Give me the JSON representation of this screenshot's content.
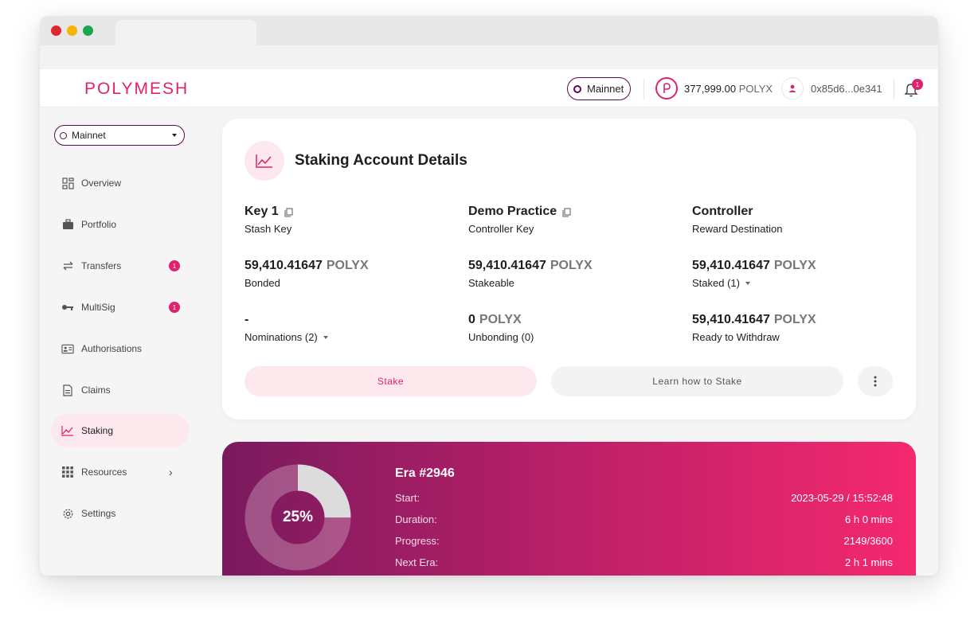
{
  "header": {
    "logo": "POLYMESH",
    "network": "Mainnet",
    "balance_value": "377,999.00",
    "balance_unit": "POLYX",
    "account": "0x85d6...0e341",
    "notification_count": "1"
  },
  "sidebar": {
    "network_select": "Mainnet",
    "items": [
      {
        "label": "Overview",
        "icon": "overview-icon"
      },
      {
        "label": "Portfolio",
        "icon": "briefcase-icon"
      },
      {
        "label": "Transfers",
        "icon": "transfer-icon",
        "badge": "1"
      },
      {
        "label": "MultiSig",
        "icon": "key-icon",
        "badge": "1"
      },
      {
        "label": "Authorisations",
        "icon": "id-card-icon"
      },
      {
        "label": "Claims",
        "icon": "document-icon"
      },
      {
        "label": "Staking",
        "icon": "chart-line-icon",
        "active": true
      },
      {
        "label": "Resources",
        "icon": "grid-icon"
      },
      {
        "label": "Settings",
        "icon": "gear-icon"
      }
    ]
  },
  "staking": {
    "title": "Staking Account Details",
    "key1_name": "Key 1",
    "key1_sub": "Stash Key",
    "key2_name": "Demo Practice",
    "key2_sub": "Controller Key",
    "key3_name": "Controller",
    "key3_sub": "Reward Destination",
    "bonded_value": "59,410.41647",
    "bonded_label": "Bonded",
    "stakeable_value": "59,410.41647",
    "stakeable_label": "Stakeable",
    "staked_value": "59,410.41647",
    "staked_label": "Staked (1)",
    "nominations_value": "-",
    "nominations_label": "Nominations (2)",
    "unbonding_value": "0",
    "unbonding_label": "Unbonding (0)",
    "withdraw_value": "59,410.41647",
    "withdraw_label": "Ready to Withdraw",
    "unit": "POLYX",
    "stake_button": "Stake",
    "learn_button": "Learn how to Stake"
  },
  "era": {
    "title": "Era #2946",
    "progress_percent": 25,
    "progress_label": "25%",
    "rows": [
      {
        "key": "Start:",
        "value": "2023-05-29 / 15:52:48"
      },
      {
        "key": "Duration:",
        "value": "6 h 0 mins"
      },
      {
        "key": "Progress:",
        "value": "2149/3600"
      },
      {
        "key": "Next Era:",
        "value": "2 h 1 mins"
      }
    ]
  },
  "colors": {
    "brand": "#e0226e",
    "network_border": "#5b0a4b",
    "active_nav_bg": "#fde8ee"
  }
}
